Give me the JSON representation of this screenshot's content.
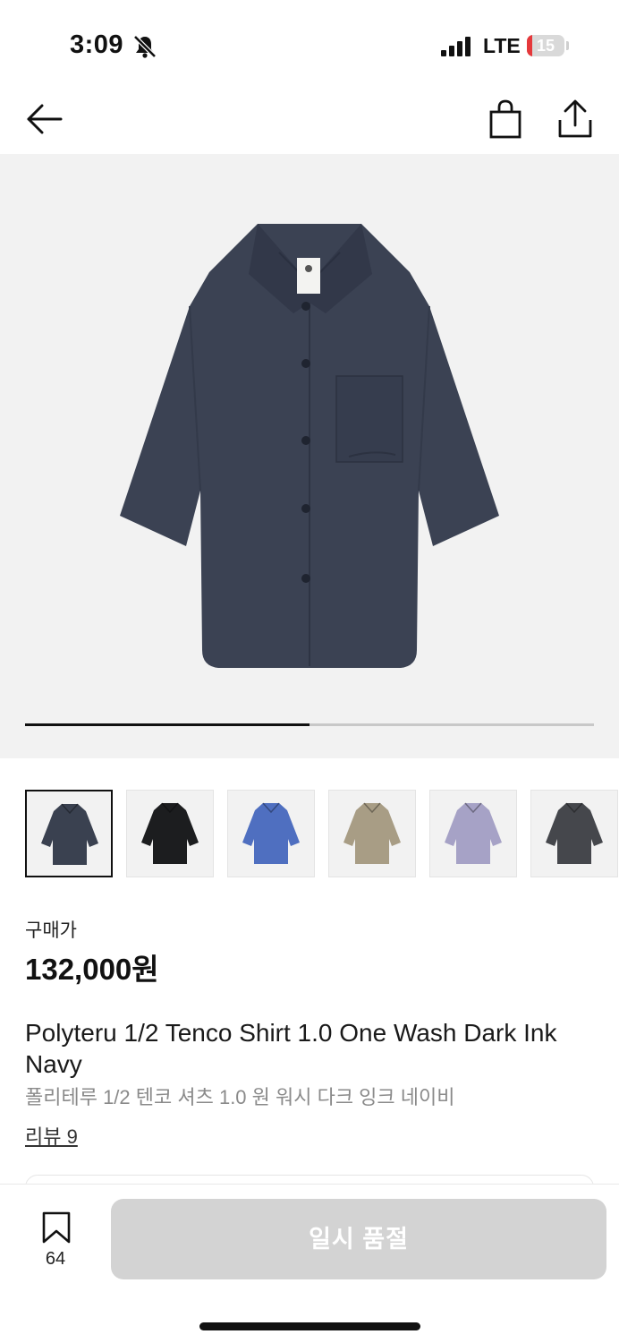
{
  "status": {
    "time": "3:09",
    "network": "LTE",
    "battery": "15",
    "battery_level": 0.15,
    "battery_color": "#e5383b"
  },
  "nav": {
    "back_icon": "arrow-left-icon",
    "bag_icon": "shopping-bag-icon",
    "share_icon": "share-icon"
  },
  "hero": {
    "image_desc": "dark-ink-navy-short-sleeve-shirt",
    "carousel_progress": 0.5
  },
  "thumbnails": [
    {
      "name": "dark-ink-navy",
      "color": "#3a4150",
      "selected": true
    },
    {
      "name": "black",
      "color": "#1c1d1f",
      "selected": false
    },
    {
      "name": "blue",
      "color": "#4f6fc0",
      "selected": false
    },
    {
      "name": "beige",
      "color": "#a89d85",
      "selected": false
    },
    {
      "name": "lavender",
      "color": "#a6a2c6",
      "selected": false
    },
    {
      "name": "charcoal",
      "color": "#45474c",
      "selected": false
    }
  ],
  "price": {
    "label": "구매가",
    "value": "132,000원"
  },
  "product": {
    "name": "Polyteru 1/2 Tenco Shirt 1.0 One Wash Dark Ink Navy",
    "name_ko": "폴리테루 1/2 텐코 셔츠 1.0 원 워시 다크 잉크 네이비"
  },
  "reviews": {
    "label": "리뷰 9"
  },
  "bottom": {
    "bookmark_count": "64",
    "bookmark_icon": "bookmark-icon",
    "soldout_label": "일시 품절"
  }
}
